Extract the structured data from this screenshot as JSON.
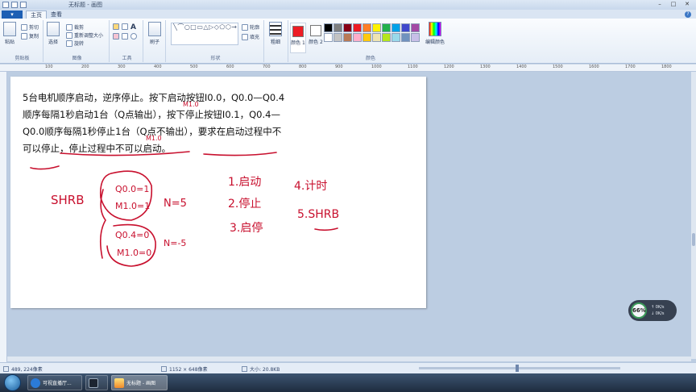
{
  "window": {
    "title": "无标题 - 画图"
  },
  "ribbon": {
    "file_tab": "▾",
    "tabs": [
      "主页",
      "查看"
    ],
    "clipboard": {
      "label": "剪贴板",
      "paste": "粘贴",
      "cut": "剪切",
      "copy": "复制"
    },
    "image": {
      "label": "图像",
      "select": "选择",
      "crop": "裁剪",
      "resize": "重新调整大小",
      "rotate": "旋转"
    },
    "tools": {
      "label": "工具"
    },
    "brushes": "刷子",
    "shapes": {
      "label": "形状",
      "outline": "轮廓",
      "fill": "填充"
    },
    "size": "粗细",
    "color1": "颜色 1",
    "color2": "颜色 2",
    "colors_label": "颜色",
    "edit_colors": "编辑颜色",
    "palette": [
      "#000000",
      "#7f7f7f",
      "#880015",
      "#ed1c24",
      "#ff7f27",
      "#fff200",
      "#22b14c",
      "#00a2e8",
      "#3f48cc",
      "#a349a4",
      "#ffffff",
      "#c3c3c3",
      "#b97a57",
      "#ffaec9",
      "#ffc90e",
      "#efe4b0",
      "#b5e61d",
      "#99d9ea",
      "#7092be",
      "#c8bfe7"
    ],
    "color1_value": "#ed1c24",
    "color2_value": "#ffffff"
  },
  "ruler": {
    "ticks": [
      "100",
      "200",
      "300",
      "400",
      "500",
      "600",
      "700",
      "800",
      "900",
      "1000",
      "1100",
      "1200",
      "1300",
      "1400",
      "1500",
      "1600",
      "1700",
      "1800"
    ]
  },
  "canvas": {
    "paragraph": "5台电机顺序启动，逆序停止。按下启动按钮I0.0，Q0.0—Q0.4顺序每隔1秒启动1台（Q点输出），按下停止按钮I0.1，Q0.4—Q0.0顺序每隔1秒停止1台（Q点不输出），要求在启动过程中不可以停止，停止过程中不可以启动。",
    "handwriting": {
      "shrb_left": "SHRB",
      "line1": "Q0.0=1",
      "line2": "M1.0=1",
      "n1": "N=5",
      "line3": "Q0.4=0",
      "line4": "M1.0=0",
      "n2": "N=-5",
      "step1": "1.启动",
      "step2": "2.停止",
      "step3": "3.启停",
      "step4": "4.计时",
      "step5": "5.SHRB",
      "mark1": "M1.0",
      "mark2": "M1.0"
    }
  },
  "status": {
    "cursor_pos": "489, 224像素",
    "image_size": "1152 × 648像素",
    "file_size": "大小: 20.8KB"
  },
  "widget": {
    "percent": "66%",
    "up": "0K/s",
    "down": "0K/s"
  },
  "taskbar": {
    "items": [
      {
        "label": "可视直播厅..."
      },
      {
        "label": ""
      },
      {
        "label": "无标题 - 画图"
      }
    ]
  }
}
